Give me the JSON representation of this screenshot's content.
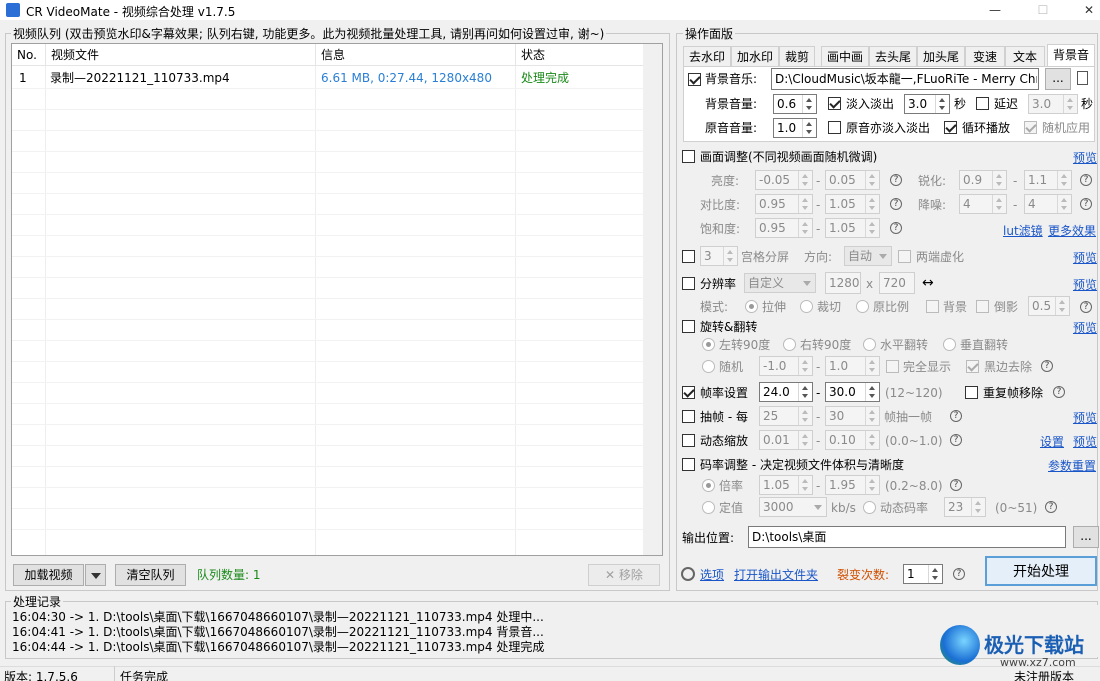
{
  "window": {
    "title": "CR VideoMate - 视频综合处理 v1.7.5",
    "min": "—",
    "max": "☐",
    "close": "✕"
  },
  "queue": {
    "group_title": "视频队列 (双击预览水印&字幕效果; 队列右键, 功能更多。此为视频批量处理工具, 请别再问如何设置过审, 谢~)",
    "columns": [
      "No.",
      "视频文件",
      "信息",
      "状态"
    ],
    "rows": [
      {
        "no": "1",
        "file": "录制—20221121_110733.mp4",
        "info": "6.61 MB, 0:27.44, 1280x480",
        "status": "处理完成"
      }
    ],
    "load_label": "加载视频",
    "clear_label": "清空队列",
    "count_label": "队列数量: 1",
    "remove_label": "移除"
  },
  "panel": {
    "group_title": "操作面版",
    "tabs": [
      "去水印",
      "加水印",
      "裁剪",
      "画中画",
      "去头尾",
      "加头尾",
      "变速",
      "文本",
      "背景音"
    ],
    "bgm": {
      "music_label": "背景音乐:",
      "music_path": "D:\\CloudMusic\\坂本龍一,FLuoRiTe - Merry Christ",
      "browse": "...",
      "vol_label": "背景音量:",
      "vol": "0.6",
      "fade_label": "淡入淡出",
      "fade_val": "3.0",
      "sec": "秒",
      "delay_label": "延迟",
      "delay_val": "3.0",
      "orig_label": "原音音量:",
      "orig_val": "1.0",
      "orig_fade": "原音亦淡入淡出",
      "loop": "循环播放",
      "random": "随机应用"
    },
    "adjust": {
      "title": "画面调整(不同视频画面随机微调)",
      "preview": "预览",
      "brightness": "亮度:",
      "b1": "-0.05",
      "b2": "0.05",
      "sharpen": "锐化:",
      "s1": "0.9",
      "s2": "1.1",
      "contrast": "对比度:",
      "c1": "0.95",
      "c2": "1.05",
      "denoise": "降噪:",
      "d1": "4",
      "d2": "4",
      "saturation": "饱和度:",
      "sa1": "0.95",
      "sa2": "1.05",
      "lut": "lut滤镜",
      "more": "更多效果"
    },
    "grid": {
      "val": "3",
      "label": "宫格分屏",
      "dir_label": "方向:",
      "dir": "自动",
      "blur": "两端虚化",
      "preview": "预览"
    },
    "resolution": {
      "label": "分辨率",
      "mode": "自定义",
      "w": "1280",
      "x": "x",
      "h": "720",
      "swap": "↔",
      "preview": "预览",
      "mode_label": "模式:",
      "stretch": "拉伸",
      "crop": "裁切",
      "ratio": "原比例",
      "bg": "背景",
      "shadow": "倒影",
      "shadow_val": "0.5"
    },
    "rotate": {
      "label": "旋转&翻转",
      "preview": "预览",
      "left90": "左转90度",
      "right90": "右转90度",
      "hflip": "水平翻转",
      "vflip": "垂直翻转",
      "random": "随机",
      "r1": "-1.0",
      "r2": "1.0",
      "full": "完全显示",
      "border": "黑边去除"
    },
    "fps": {
      "label": "帧率设置",
      "v1": "24.0",
      "v2": "30.0",
      "range": "(12~120)",
      "dedup": "重复帧移除"
    },
    "extract": {
      "label": "抽帧 - 每",
      "v1": "25",
      "v2": "30",
      "suffix": "帧抽一帧",
      "preview": "预览"
    },
    "zoom": {
      "label": "动态缩放",
      "v1": "0.01",
      "v2": "0.10",
      "range": "(0.0~1.0)",
      "settings": "设置",
      "preview": "预览"
    },
    "bitrate": {
      "label": "码率调整 - 决定视频文件体积与清晰度",
      "reset": "参数重置",
      "rate": "倍率",
      "r1": "1.05",
      "r2": "1.95",
      "range1": "(0.2~8.0)",
      "fixed": "定值",
      "fixed_val": "3000",
      "unit": "kb/s",
      "dyn": "动态码率",
      "dyn_val": "23",
      "range2": "(0~51)"
    },
    "output_label": "输出位置:",
    "output_path": "D:\\tools\\桌面",
    "options": "选项",
    "open_folder": "打开输出文件夹",
    "split_label": "裂变次数:",
    "split_val": "1",
    "start": "开始处理"
  },
  "log": {
    "title": "处理记录",
    "lines": [
      "16:04:30 -> 1. D:\\tools\\桌面\\下载\\1667048660107\\录制—20221121_110733.mp4 处理中...",
      "16:04:41 -> 1. D:\\tools\\桌面\\下载\\1667048660107\\录制—20221121_110733.mp4 背景音...",
      "16:04:44 -> 1. D:\\tools\\桌面\\下载\\1667048660107\\录制—20221121_110733.mp4 处理完成"
    ]
  },
  "status": {
    "version": "版本: 1.7.5.6",
    "task": "任务完成",
    "reg": "未注册版本"
  },
  "watermark": {
    "cn": "极光下载站",
    "url": "www.xz7.com"
  }
}
